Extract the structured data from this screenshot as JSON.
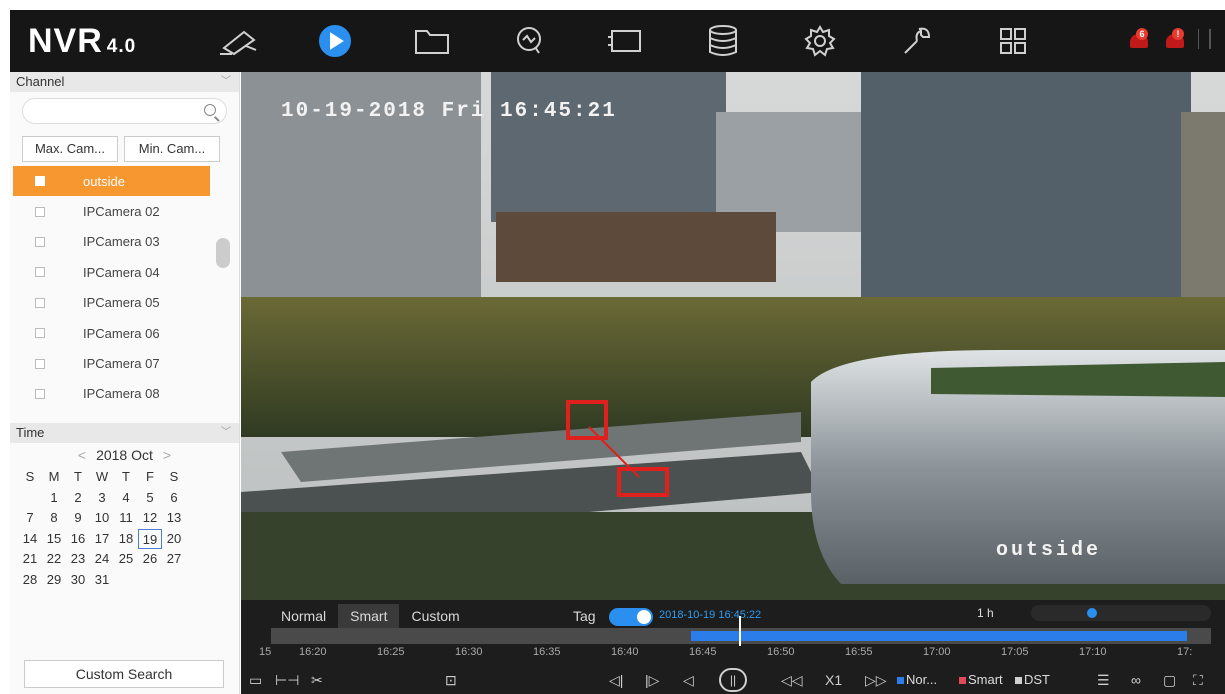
{
  "topbar": {
    "logo": "NVR",
    "version": "4.0",
    "nav": [
      "live-view-icon",
      "playback-icon",
      "file-management-icon",
      "smart-analysis-icon",
      "device-icon",
      "storage-icon",
      "configuration-icon",
      "maintenance-icon",
      "menu-grid-icon"
    ],
    "active_nav": "playback-icon",
    "alerts": [
      "6",
      "!"
    ]
  },
  "channel": {
    "title": "Channel",
    "max_cam": "Max. Cam...",
    "min_cam": "Min. Cam...",
    "items": [
      {
        "label": "outside",
        "selected": true
      },
      {
        "label": "IPCamera 02",
        "selected": false
      },
      {
        "label": "IPCamera 03",
        "selected": false
      },
      {
        "label": "IPCamera 04",
        "selected": false
      },
      {
        "label": "IPCamera 05",
        "selected": false
      },
      {
        "label": "IPCamera 06",
        "selected": false
      },
      {
        "label": "IPCamera 07",
        "selected": false
      },
      {
        "label": "IPCamera 08",
        "selected": false
      }
    ]
  },
  "time": {
    "title": "Time",
    "month": "2018 Oct",
    "weekdays": [
      "S",
      "M",
      "T",
      "W",
      "T",
      "F",
      "S"
    ],
    "days": [
      "",
      "1",
      "2",
      "3",
      "4",
      "5",
      "6",
      "7",
      "8",
      "9",
      "10",
      "11",
      "12",
      "13",
      "14",
      "15",
      "16",
      "17",
      "18",
      "19",
      "20",
      "21",
      "22",
      "23",
      "24",
      "25",
      "26",
      "27",
      "28",
      "29",
      "30",
      "31"
    ],
    "selected_day": "19",
    "custom_search": "Custom Search"
  },
  "video": {
    "timestamp": "10-19-2018 Fri 16:45:21",
    "camera_name": "outside"
  },
  "timeline": {
    "modes": [
      "Normal",
      "Smart",
      "Custom"
    ],
    "active_mode": "Smart",
    "tag_label": "Tag",
    "tag_enabled": true,
    "current_time": "2018-10-19 16:45:22",
    "span": "1 h",
    "ticks": [
      "15",
      "16:20",
      "16:25",
      "16:30",
      "16:35",
      "16:40",
      "16:45",
      "16:50",
      "16:55",
      "17:00",
      "17:05",
      "17:10",
      "17:"
    ],
    "speed": "X1",
    "legend": {
      "normal": "Nor...",
      "smart": "Smart",
      "dst": "DST"
    },
    "colors": {
      "normal": "#2b7de9",
      "smart": "#e04a5a",
      "dst": "#cfcfcf",
      "accent": "#f6972f"
    }
  }
}
